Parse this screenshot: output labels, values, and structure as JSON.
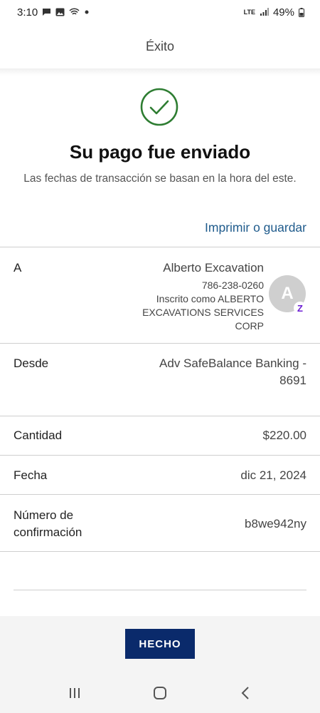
{
  "status_bar": {
    "time": "3:10",
    "network": "LTE",
    "battery": "49%"
  },
  "header": {
    "title": "Éxito"
  },
  "confirmation": {
    "title": "Su pago fue enviado",
    "subtitle": "Las fechas de transacción se basan en la hora del este.",
    "print_link": "Imprimir o guardar",
    "accent_color": "#2e7d32",
    "link_color": "#1f5b8c"
  },
  "recipient": {
    "label": "A",
    "name": "Alberto Excavation",
    "phone": "786-238-0260",
    "enrolled_as": "Inscrito como ALBERTO EXCAVATIONS SERVICES CORP",
    "avatar_initial": "A",
    "badge_icon": "zelle-icon",
    "badge_letter": "Z"
  },
  "details": {
    "from_label": "Desde",
    "from_value": "Adv SafeBalance Banking - 8691",
    "amount_label": "Cantidad",
    "amount_value": "$220.00",
    "date_label": "Fecha",
    "date_value": "dic 21, 2024",
    "confirmation_label": "Número de confirmación",
    "confirmation_value": "b8we942ny"
  },
  "footer": {
    "done_label": "HECHO",
    "button_color": "#0a2a6b"
  },
  "navbar": {
    "icons": [
      "recent-apps-icon",
      "home-icon",
      "back-icon"
    ]
  }
}
